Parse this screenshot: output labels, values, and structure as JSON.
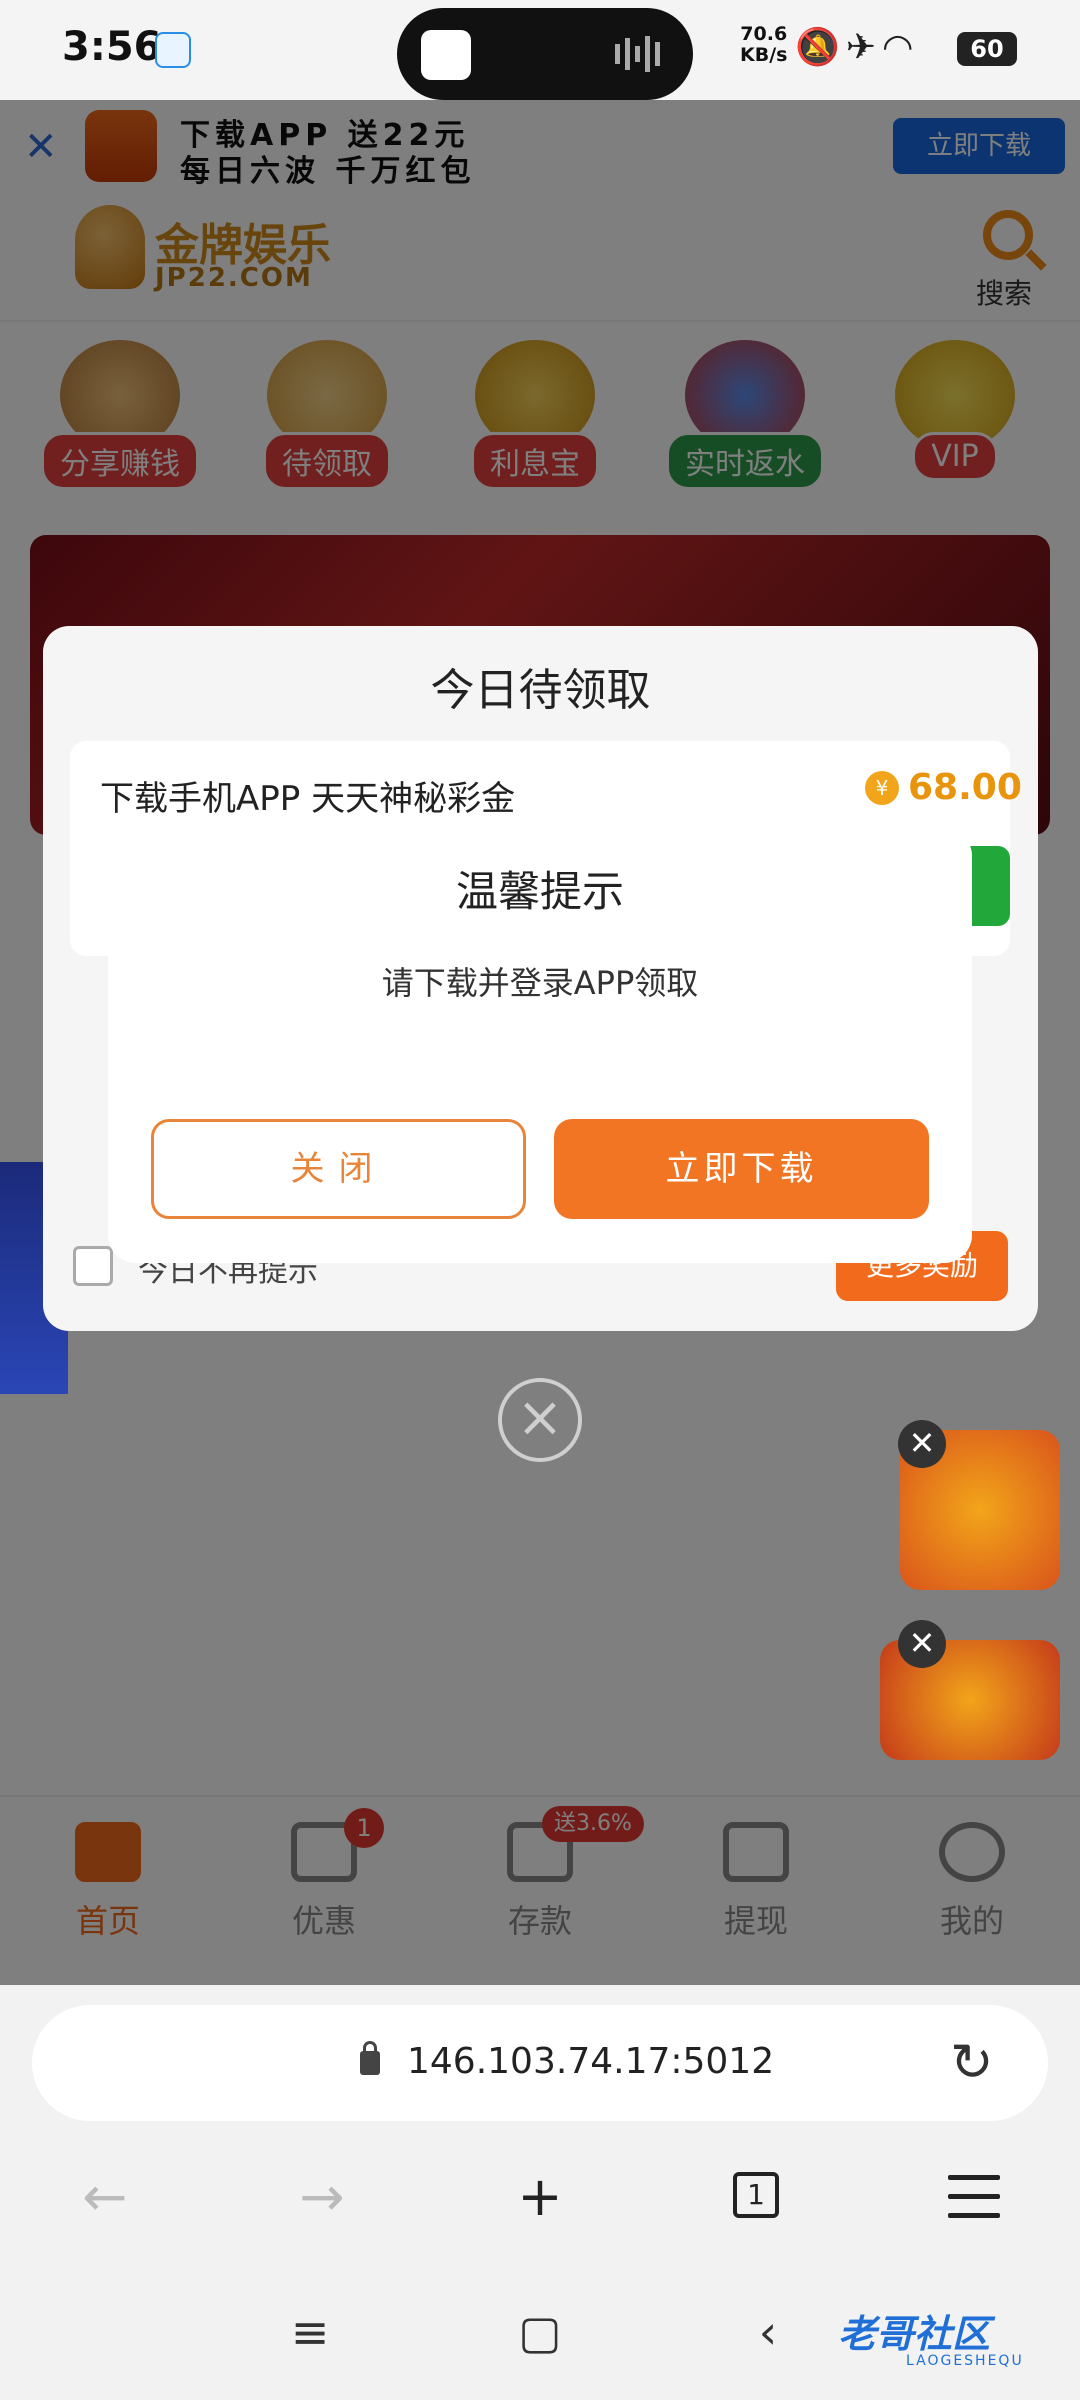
{
  "status_bar": {
    "time": "3:56",
    "net_speed_value": "70.6",
    "net_speed_unit": "KB/s",
    "battery": "60"
  },
  "app_banner": {
    "line1": "下载APP 送22元",
    "line2": "每日六波 千万红包",
    "download_label": "立即下载"
  },
  "header": {
    "site_name": "金牌娱乐",
    "site_url": "JP22.COM",
    "search_label": "搜索"
  },
  "quick_menu": [
    {
      "label": "分享赚钱"
    },
    {
      "label": "待领取"
    },
    {
      "label": "利息宝"
    },
    {
      "label": "实时返水"
    },
    {
      "label": "VIP"
    }
  ],
  "pending_panel": {
    "title": "今日待领取",
    "item_text": "下载手机APP 天天神秘彩金",
    "item_amount": "68.00",
    "no_remind_label": "今日不再提示",
    "more_rewards_label": "更多奖励"
  },
  "dialog": {
    "title": "温馨提示",
    "message": "请下载并登录APP领取",
    "close_label": "关闭",
    "download_label": "立即下载"
  },
  "tab_bar": {
    "tabs": [
      {
        "label": "首页",
        "active": true
      },
      {
        "label": "优惠",
        "badge": "1"
      },
      {
        "label": "存款",
        "bonus": "送3.6%"
      },
      {
        "label": "提现"
      },
      {
        "label": "我的"
      }
    ]
  },
  "browser": {
    "url": "146.103.74.17:5012",
    "tab_count": "1"
  },
  "watermark": {
    "text": "老哥社区",
    "sub": "LAOGESHEQU"
  },
  "colors": {
    "accent": "#f27523",
    "brand_blue": "#1769e0",
    "gold": "#e8950d"
  }
}
